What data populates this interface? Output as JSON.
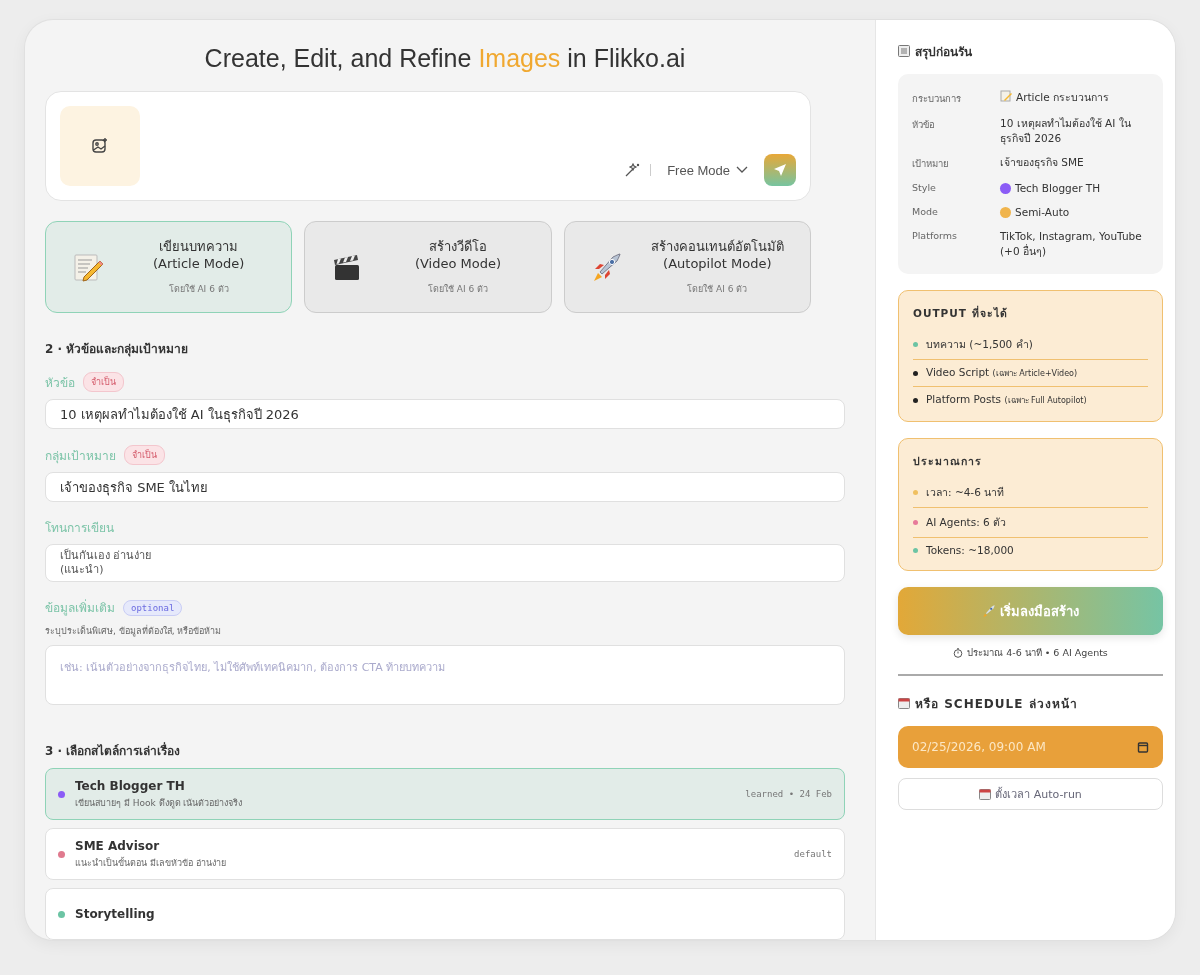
{
  "header": {
    "title_before": "Create, Edit, and Refine ",
    "title_highlight": "Images",
    "title_after": " in Flikko.ai"
  },
  "prompt": {
    "mode_label": "Free Mode"
  },
  "modes": [
    {
      "kind": "article",
      "title": "เขียนบทความ",
      "subtitle": "(Article Mode)",
      "note": "โดยใช้ AI 6 ตัว",
      "selected": true
    },
    {
      "kind": "video",
      "title": "สร้างวีดีโอ",
      "subtitle": "(Video Mode)",
      "note": "โดยใช้ AI 6 ตัว",
      "selected": false
    },
    {
      "kind": "autopilot",
      "title": "สร้างคอนเทนต์อัตโนมัติ",
      "subtitle": "(Autopilot Mode)",
      "note": "โดยใช้ AI 6 ตัว",
      "selected": false
    }
  ],
  "topic_section": {
    "heading": "2 · หัวข้อและกลุ่มเป้าหมาย",
    "fields": [
      {
        "kind": "input",
        "label": "หัวข้อ",
        "badge": {
          "text": "จำเป็น",
          "kind": "required"
        },
        "value": "10 เหตุผลทำไมต้องใช้ AI ในธุรกิจปี 2026"
      },
      {
        "kind": "input",
        "label": "กลุ่มเป้าหมาย",
        "badge": {
          "text": "จำเป็น",
          "kind": "required"
        },
        "value": "เจ้าของธุรกิจ SME ในไทย"
      },
      {
        "kind": "select",
        "label": "โทนการเขียน",
        "value": "เป็นกันเอง อ่านง่าย\n(แนะนำ)"
      },
      {
        "kind": "textarea",
        "label": "ข้อมูลเพิ่มเติม",
        "badge": {
          "text": "optional",
          "kind": "optional"
        },
        "hint": "ระบุประเด็นพิเศษ, ข้อมูลที่ต้องใส่, หรือข้อห้าม",
        "placeholder": "เช่น: เน้นตัวอย่างจากธุรกิจไทย, ไม่ใช้ศัพท์เทคนิคมาก, ต้องการ CTA ท้ายบทความ"
      }
    ]
  },
  "style_section": {
    "heading": "3 · เลือกสไตล์การเล่าเรื่อง",
    "styles": [
      {
        "name": "Tech Blogger TH",
        "description": "เขียนสบายๆ มี Hook ดึงดูด เน้นตัวอย่างจริง",
        "meta": "learned • 24 Feb",
        "color": "#8b5cf6",
        "selected": true
      },
      {
        "name": "SME Advisor",
        "description": "แนะนำเป็นขั้นตอน มีเลขหัวข้อ อ่านง่าย",
        "meta": "default",
        "color": "#e07a8e",
        "selected": false
      },
      {
        "name": "Storytelling",
        "color": "#6cc4a4",
        "selected": false
      }
    ]
  },
  "sidebar": {
    "summary": {
      "title": "สรุปก่อนรัน",
      "rows": [
        {
          "kind": "icon",
          "label": "กระบวนการ",
          "value": "Article กระบวนการ"
        },
        {
          "kind": "text",
          "label": "หัวข้อ",
          "value": "10 เหตุผลทำไมต้องใช้ AI ในธุรกิจปี 2026"
        },
        {
          "kind": "text",
          "label": "เป้าหมาย",
          "value": "เจ้าของธุรกิจ SME"
        },
        {
          "kind": "dot",
          "label": "Style",
          "value": "Tech Blogger TH",
          "color": "#8b5cf6"
        },
        {
          "kind": "dot",
          "label": "Mode",
          "value": "Semi-Auto",
          "color": "#f0b44c"
        },
        {
          "kind": "text",
          "label": "Platforms",
          "value": "TikTok, Instagram, YouTube (+0 อื่นๆ)"
        }
      ]
    },
    "output": {
      "title": "OUTPUT ที่จะได้",
      "items": [
        {
          "text": "บทความ (~1,500 คำ)",
          "color": "#6cc4a4"
        },
        {
          "text": "Video Script",
          "note": "(เฉพาะ Article+Video)",
          "color": "#222222"
        },
        {
          "text": "Platform Posts",
          "note": "(เฉพาะ Full Autopilot)",
          "color": "#222222"
        }
      ]
    },
    "estimate": {
      "title": "ประมาณการ",
      "items": [
        {
          "text": "เวลา: ~4-6 นาที",
          "color": "#f0c060"
        },
        {
          "text": "AI Agents: 6 ตัว",
          "color": "#e77a9a"
        },
        {
          "text": "Tokens: ~18,000",
          "color": "#6cc4a4"
        }
      ]
    },
    "start_button": {
      "label": "เริ่มลงมือสร้าง"
    },
    "start_note": "ประมาณ 4-6 นาที • 6 AI Agents",
    "schedule": {
      "title": "หรือ SCHEDULE ล่วงหน้า",
      "datetime": "02/25/2026, 09:00 AM",
      "button": "ตั้งเวลา Auto-run"
    }
  }
}
